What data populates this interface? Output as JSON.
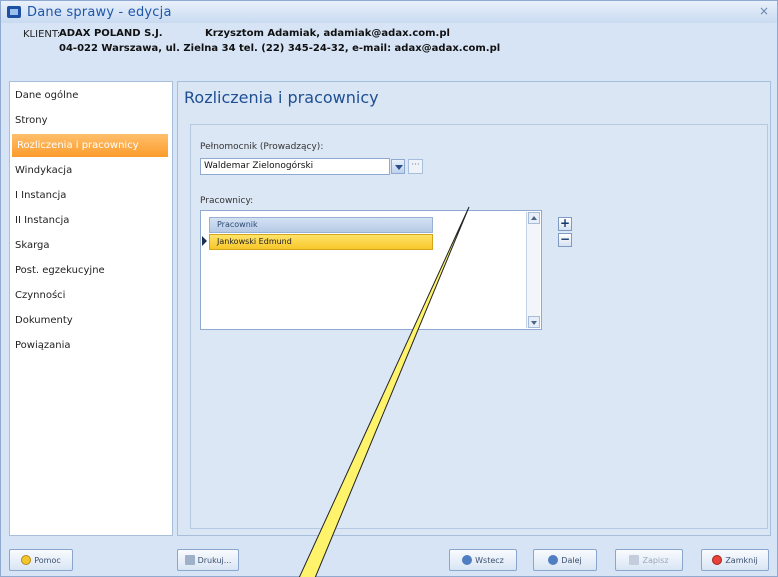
{
  "window": {
    "title": "Dane sprawy - edycja",
    "close_glyph": "×"
  },
  "client": {
    "label": "KLIENT:",
    "name": "ADAX POLAND S.J.",
    "contact": "Krzysztom Adamiak, adamiak@adax.com.pl",
    "address": "04-022 Warszawa, ul. Zielna 34    tel. (22) 345-24-32, e-mail: adax@adax.com.pl"
  },
  "sidebar": {
    "items": [
      {
        "label": "Dane ogólne"
      },
      {
        "label": "Strony"
      },
      {
        "label": "Rozliczenia i pracownicy",
        "active": true
      },
      {
        "label": "Windykacja"
      },
      {
        "label": "I Instancja"
      },
      {
        "label": "II Instancja"
      },
      {
        "label": "Skarga"
      },
      {
        "label": "Post. egzekucyjne"
      },
      {
        "label": "Czynności"
      },
      {
        "label": "Dokumenty"
      },
      {
        "label": "Powiązania"
      }
    ]
  },
  "main": {
    "title": "Rozliczenia i pracownicy",
    "attorney_label": "Pełnomocnik (Prowadzący):",
    "attorney_value": "Waldemar Zielonogórski",
    "dots": "···",
    "workers_label": "Pracownicy:",
    "grid": {
      "header": "Pracownik",
      "rows": [
        "Jankowski Edmund"
      ]
    },
    "plus": "+",
    "minus": "−"
  },
  "buttons": {
    "help": "Pomoc",
    "print": "Drukuj...",
    "back": "Wstecz",
    "next": "Dalej",
    "save": "Zapisz",
    "close": "Zamknij"
  },
  "colors": {
    "accent": "#fb9c2c",
    "selected_row": "#f7c72a",
    "title_blue": "#1e4f93",
    "annotation_line": "#fff36b"
  },
  "icons": {
    "app": "app-window-icon",
    "help": "help-icon",
    "print": "printer-icon",
    "back": "arrow-left-icon",
    "next": "arrow-right-icon",
    "save": "save-icon",
    "close": "close-circle-icon"
  }
}
